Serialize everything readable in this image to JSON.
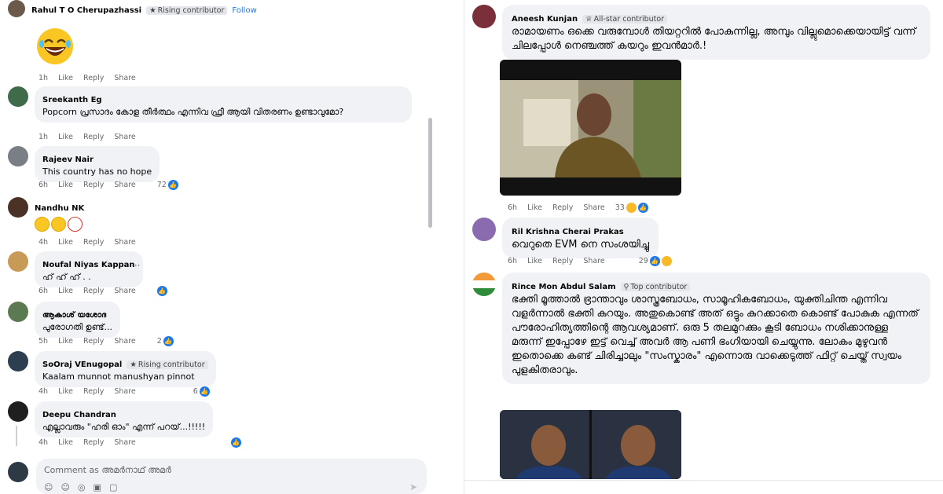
{
  "left": {
    "comments": [
      {
        "author": "Rahul T O Cherupazhassi",
        "badge": "Rising contributor",
        "follow": "Follow",
        "text": "",
        "time": "1h",
        "like": "Like",
        "reply": "Reply",
        "share": "Share",
        "count": ""
      },
      {
        "author": "Sreekanth Eg",
        "badge": "",
        "text": "Popcorn പ്രസാദം കോള തീർത്ഥം എന്നിവ ഫ്രീ ആയി വിതരണം ഉണ്ടാവുമോ?",
        "time": "1h",
        "like": "Like",
        "reply": "Reply",
        "share": "Share",
        "count": ""
      },
      {
        "author": "Rajeev Nair",
        "badge": "",
        "text": "This country has no hope",
        "time": "6h",
        "like": "Like",
        "reply": "Reply",
        "share": "Share",
        "count": "72"
      },
      {
        "author": "Nandhu NK",
        "badge": "",
        "text": "",
        "time": "4h",
        "like": "Like",
        "reply": "Reply",
        "share": "Share",
        "count": ""
      },
      {
        "author": "Noufal Niyas Kappan",
        "badge": "",
        "text": "ഹ് ഹ് ഹ് . .",
        "time": "6h",
        "like": "Like",
        "reply": "Reply",
        "share": "Share",
        "count": ""
      },
      {
        "author": "ആകാശ് യശോദ",
        "badge": "",
        "text": "പുരോഗതി ഉണ്ട്...",
        "time": "5h",
        "like": "Like",
        "reply": "Reply",
        "share": "Share",
        "count": "2"
      },
      {
        "author": "SoOraj VEnugopal",
        "badge": "Rising contributor",
        "text": "Kaalam munnot manushyan pinnot",
        "time": "4h",
        "like": "Like",
        "reply": "Reply",
        "share": "Share",
        "count": "6"
      },
      {
        "author": "Deepu Chandran",
        "badge": "",
        "text": "എല്ലാവരും \"ഹരി ഓം\" എന്ന് പറയ്...!!!!!",
        "time": "4h",
        "like": "Like",
        "reply": "Reply",
        "share": "Share",
        "count": ""
      }
    ],
    "composer": {
      "placeholder": "Comment as അമർനാഥ് അമർ"
    }
  },
  "right": {
    "comments": [
      {
        "author": "Aneesh Kunjan",
        "badge": "All-star contributor",
        "text": "രാമായണം ഒക്കെ വരുമ്പോൾ തിയറ്ററിൽ പോകുന്നില്ല, അമ്പും വില്ലുമൊക്കെയായിട്ട് വന്ന് ചിലപ്പോൾ നെഞ്ചത്ത് കയറും ഇവൻമാർ.!",
        "time": "6h",
        "like": "Like",
        "reply": "Reply",
        "share": "Share",
        "count": "33"
      },
      {
        "author": "Ril Krishna Cherai Prakas",
        "badge": "",
        "text": "വെറുതെ EVM നെ സംശയിച്ചു",
        "time": "6h",
        "like": "Like",
        "reply": "Reply",
        "share": "Share",
        "count": "29"
      },
      {
        "author": "Rince Mon Abdul Salam",
        "badge": "Top contributor",
        "text": "ഭക്തി മൂത്താൽ ഭ്രാന്താവും ശാസ്ത്രബോധം, സാമൂഹികബോധം, യുക്തിചിന്ത എന്നിവ വളർന്നാൽ ഭക്തി കുറയും. അതുകൊണ്ട് അത് ഒട്ടും കുറക്കാതെ കൊണ്ട് പോകുക എന്നത് പൗരോഹിത്യത്തിന്റെ ആവശ്യമാണ്. ഒരു 5 തലമുറക്കും കൂടി ബോധം നശിക്കാനുള്ള മരുന്ന് ഇപ്പോഴേ ഇട്ട് വെച്ച് അവർ ആ പണി ഭംഗിയായി ചെയ്യുന്നു. ലോകം മുഴുവൻ ഇതൊക്കെ കണ്ട് ചിരിച്ചാലും \"സംസ്കാരം\" എന്നൊരു വാക്കെടുത്ത് ഫിറ്റ് ചെയ്ത് സ്വയം പുളകിതരാവും.",
        "time": "",
        "like": "",
        "reply": "",
        "share": "",
        "count": ""
      }
    ]
  },
  "colors": {
    "bubble": "#f0f2f5",
    "link": "#1877f2",
    "meta": "#65676b"
  }
}
